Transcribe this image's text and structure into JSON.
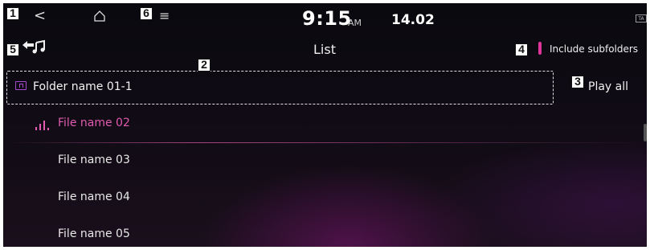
{
  "status_bar": {
    "time": "9:15",
    "ampm": "AM",
    "date": "14.02",
    "indicator": "TA"
  },
  "header": {
    "title": "List",
    "include_subfolders_label": "Include subfolders"
  },
  "folder": {
    "label": "Folder name 01-1"
  },
  "play_all_label": "Play all",
  "files": [
    {
      "label": "File name 02",
      "playing": true
    },
    {
      "label": "File name 03",
      "playing": false
    },
    {
      "label": "File name 04",
      "playing": false
    },
    {
      "label": "File name 05",
      "playing": false
    }
  ],
  "callouts": [
    "1",
    "2",
    "3",
    "4",
    "5",
    "6"
  ],
  "colors": {
    "accent": "#e25bb0",
    "folder_icon": "#a84ad0",
    "background": "#0e0b12"
  },
  "icons": [
    "back-icon",
    "home-icon",
    "menu-icon",
    "folder-up-icon",
    "now-playing-icon",
    "back-to-music-icon"
  ]
}
